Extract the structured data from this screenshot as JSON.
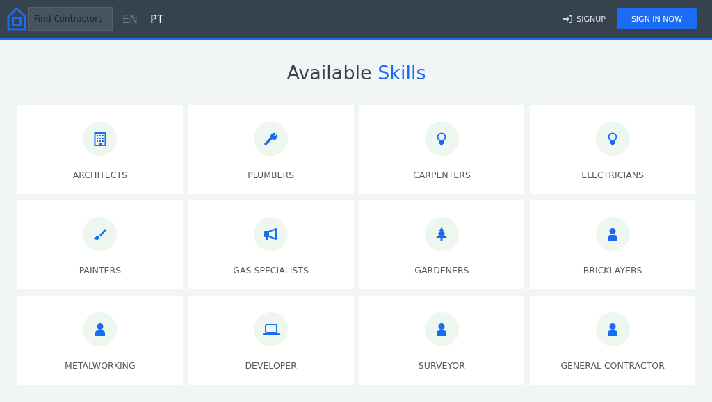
{
  "header": {
    "search": {
      "placeholder": "Find Contractors"
    },
    "languages": [
      {
        "label": "EN",
        "selected": false
      },
      {
        "label": "PT",
        "selected": true
      }
    ],
    "signup": "SIGNUP",
    "sign_in": "SIGN IN NOW"
  },
  "title": {
    "text": "Available ",
    "highlight": "Skills"
  },
  "skills": [
    {
      "label": "ARCHITECTS",
      "kind": "building"
    },
    {
      "label": "PLUMBERS",
      "kind": "wrench"
    },
    {
      "label": "CARPENTERS",
      "kind": "bulb"
    },
    {
      "label": "ELECTRICIANS",
      "kind": "bulb"
    },
    {
      "label": "PAINTERS",
      "kind": "brush"
    },
    {
      "label": "GAS SPECIALISTS",
      "kind": "megaphone"
    },
    {
      "label": "GARDENERS",
      "kind": "tree"
    },
    {
      "label": "BRICKLAYERS",
      "kind": "person"
    },
    {
      "label": "METALWORKING",
      "kind": "person"
    },
    {
      "label": "DEVELOPER",
      "kind": "laptop"
    },
    {
      "label": "SURVEYOR",
      "kind": "person"
    },
    {
      "label": "GENERAL CONTRACTOR",
      "kind": "person"
    }
  ]
}
